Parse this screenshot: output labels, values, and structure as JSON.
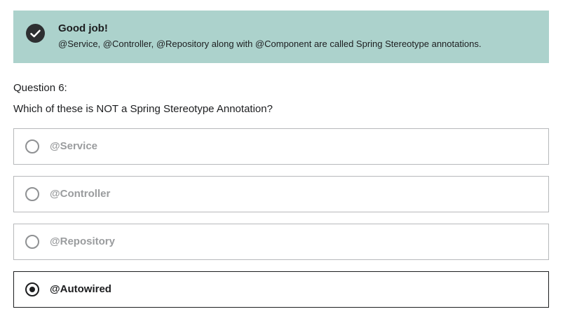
{
  "feedback": {
    "icon": "check-circle-icon",
    "title": "Good job!",
    "message": "@Service, @Controller, @Repository along with @Component are called Spring Stereotype annotations.",
    "background_color": "#acd2cc"
  },
  "question": {
    "label": "Question 6:",
    "text": "Which of these is NOT a Spring Stereotype Annotation?"
  },
  "options": [
    {
      "label": "@Service",
      "selected": false
    },
    {
      "label": "@Controller",
      "selected": false
    },
    {
      "label": "@Repository",
      "selected": false
    },
    {
      "label": "@Autowired",
      "selected": true
    }
  ]
}
